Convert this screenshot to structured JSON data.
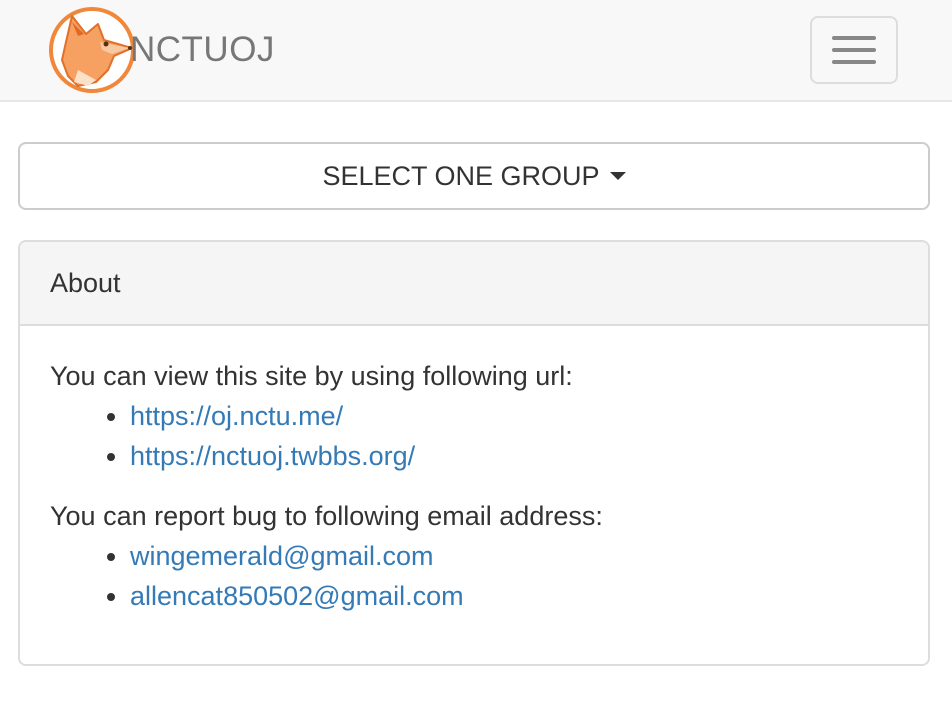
{
  "navbar": {
    "brand_text": "NCTUOJ",
    "logo_icon": "fox-logo-icon",
    "menu_icon": "hamburger-menu-icon"
  },
  "group_select": {
    "label": "SELECT ONE GROUP",
    "icon": "caret-down-icon"
  },
  "about": {
    "heading": "About",
    "urls_intro": "You can view this site by using following url:",
    "urls": [
      "https://oj.nctu.me/",
      "https://nctuoj.twbbs.org/"
    ],
    "email_intro": "You can report bug to following email address:",
    "emails": [
      "wingemerald@gmail.com",
      "allencat850502@gmail.com"
    ]
  },
  "colors": {
    "navbar_bg": "#f8f8f8",
    "link": "#337ab7",
    "logo_orange": "#f28a3c",
    "text": "#333333"
  }
}
